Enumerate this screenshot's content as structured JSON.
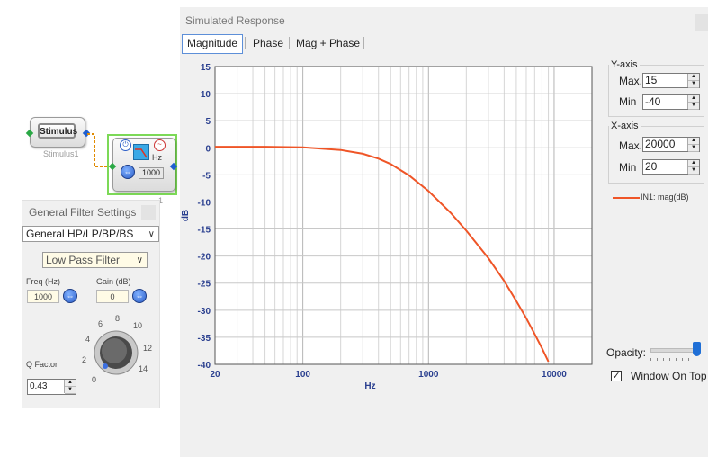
{
  "canvas": {
    "stimulus_label": "Stimulus",
    "stimulus_caption": "Stimulus1",
    "filter_hz_label": "Hz",
    "filter_value": "1000",
    "filter_caption": "1"
  },
  "filter_panel": {
    "title": "General Filter Settings",
    "type_select": "General HP/LP/BP/BS",
    "filter_select": "Low Pass Filter",
    "freq_label": "Freq (Hz)",
    "freq_value": "1000",
    "gain_label": "Gain (dB)",
    "gain_value": "0",
    "q_label": "Q Factor",
    "q_value": "0.43",
    "knob_ticks": [
      "0",
      "2",
      "4",
      "6",
      "8",
      "10",
      "12",
      "14"
    ]
  },
  "window": {
    "title": "Simulated Response",
    "tabs": [
      {
        "label": "Magnitude",
        "active": true
      },
      {
        "label": "Phase",
        "active": false
      },
      {
        "label": "Mag + Phase",
        "active": false
      }
    ]
  },
  "yaxis_panel": {
    "legend": "Y-axis",
    "max_label": "Max.",
    "max_value": "15",
    "min_label": "Min",
    "min_value": "-40"
  },
  "xaxis_panel": {
    "legend": "X-axis",
    "max_label": "Max.",
    "max_value": "20000",
    "min_label": "Min",
    "min_value": "20"
  },
  "legend_entry": "IN1: mag(dB)",
  "opacity_label": "Opacity:",
  "window_on_top_label": "Window On Top",
  "window_on_top_checked": true,
  "colors": {
    "curve": "#ef5527",
    "grid": "#c8c8c8",
    "axis_text": "#2a3f8f",
    "selected_block": "#7cd957"
  },
  "chart_data": {
    "type": "line",
    "xlabel": "Hz",
    "ylabel": "dB",
    "xscale": "log",
    "xlim": [
      20,
      20000
    ],
    "ylim": [
      -40,
      15
    ],
    "x_ticks": [
      20,
      100,
      1000,
      10000
    ],
    "x_tick_labels": [
      "20",
      "100",
      "1000",
      "10000"
    ],
    "y_ticks": [
      15,
      10,
      5,
      0,
      -5,
      -10,
      -15,
      -20,
      -25,
      -30,
      -35,
      -40
    ],
    "y_tick_labels": [
      "15",
      "10",
      "5",
      "0",
      "-5",
      "-10",
      "-15",
      "-20",
      "-25",
      "-30",
      "-35",
      "-40"
    ],
    "grid": true,
    "series": [
      {
        "name": "IN1: mag(dB)",
        "x": [
          20,
          50,
          100,
          200,
          300,
          400,
          500,
          700,
          1000,
          1500,
          2000,
          3000,
          4000,
          5000,
          6000,
          7000,
          8000,
          9000
        ],
        "y": [
          0.2,
          0.2,
          0.1,
          -0.4,
          -1.1,
          -2.0,
          -3.0,
          -5.1,
          -8.0,
          -12.0,
          -15.3,
          -20.4,
          -24.6,
          -28.3,
          -31.5,
          -34.4,
          -37.0,
          -39.5
        ]
      }
    ]
  }
}
